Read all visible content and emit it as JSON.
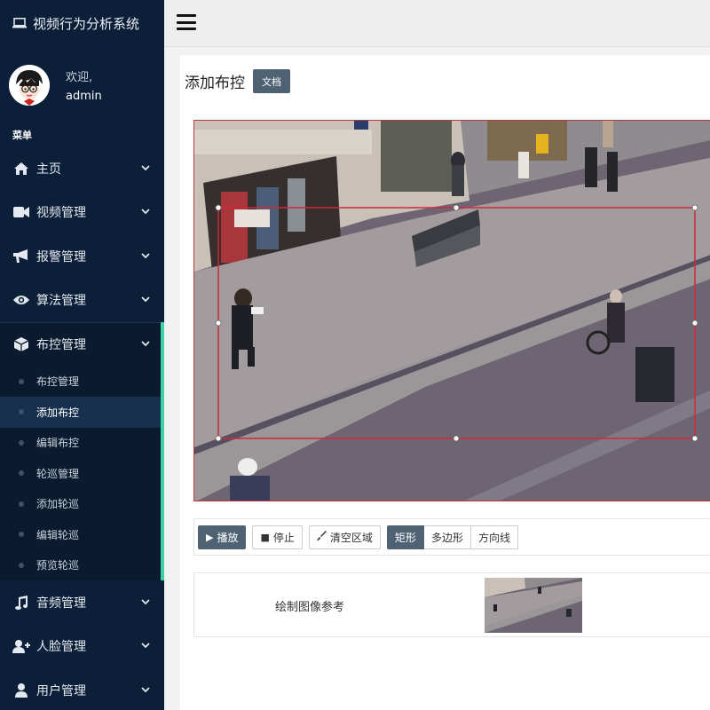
{
  "app": {
    "title": "视频行为分析系统"
  },
  "user": {
    "welcome": "欢迎,",
    "name": "admin"
  },
  "sidebar": {
    "menu_header": "菜单",
    "items": [
      {
        "label": "主页",
        "icon": "home-icon"
      },
      {
        "label": "视频管理",
        "icon": "video-camera-icon"
      },
      {
        "label": "报警管理",
        "icon": "bullhorn-icon"
      },
      {
        "label": "算法管理",
        "icon": "eye-icon"
      },
      {
        "label": "布控管理",
        "icon": "cube-icon",
        "expanded": true
      },
      {
        "label": "音频管理",
        "icon": "music-icon"
      },
      {
        "label": "人脸管理",
        "icon": "user-plus-icon"
      },
      {
        "label": "用户管理",
        "icon": "user-icon"
      }
    ],
    "subitems": [
      {
        "label": "布控管理"
      },
      {
        "label": "添加布控",
        "active": true
      },
      {
        "label": "编辑布控"
      },
      {
        "label": "轮巡管理"
      },
      {
        "label": "添加轮巡"
      },
      {
        "label": "编辑轮巡"
      },
      {
        "label": "预览轮巡"
      }
    ]
  },
  "topbar": {
    "menu_icon": "hamburger-icon"
  },
  "page": {
    "title": "添加布控",
    "doc_button": "文档"
  },
  "toolbar": {
    "play": "播放",
    "stop": "停止",
    "clear": "清空区域",
    "shape_rect": "矩形",
    "shape_polygon": "多边形",
    "direction_line": "方向线",
    "active_shape": "矩形"
  },
  "reference": {
    "label": "绘制图像参考"
  },
  "colors": {
    "sidebar_bg": "#0c1f38",
    "accent": "#3fd1a5",
    "dark_button": "#4f6274",
    "roi_stroke": "#d0283a"
  }
}
